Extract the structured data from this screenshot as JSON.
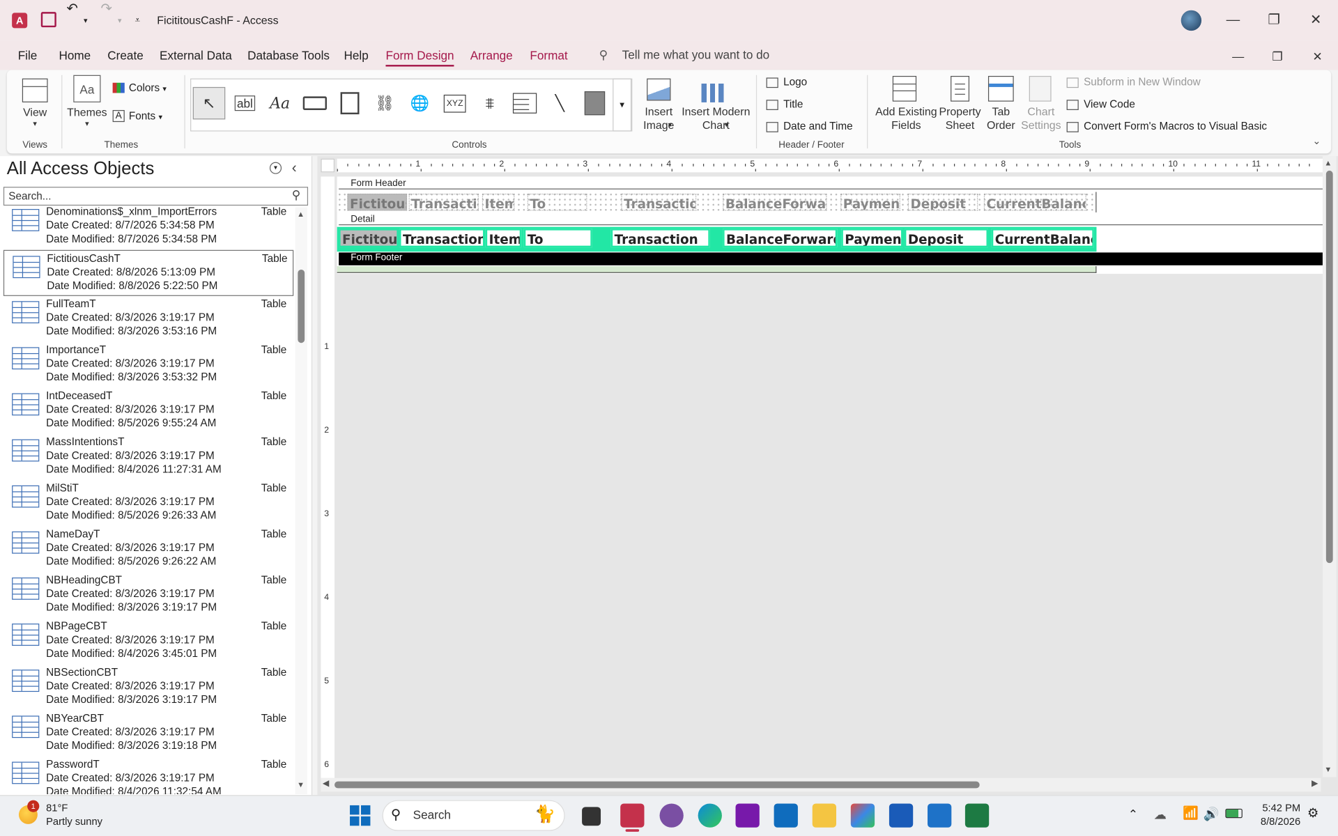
{
  "window": {
    "app_title": "FicititousCashF  -  Access"
  },
  "menu": {
    "file": "File",
    "home": "Home",
    "create": "Create",
    "external": "External Data",
    "dbtools": "Database Tools",
    "help": "Help",
    "form_design": "Form Design",
    "arrange": "Arrange",
    "format": "Format",
    "tellme": "Tell me what you want to do"
  },
  "ribbon": {
    "views": {
      "view": "View",
      "group": "Views"
    },
    "themes": {
      "themes": "Themes",
      "colors": "Colors",
      "fonts": "Fonts",
      "group": "Themes"
    },
    "controls": {
      "group": "Controls",
      "insert_image": "Insert Image",
      "insert_chart": "Insert Modern Chart"
    },
    "header_footer": {
      "logo": "Logo",
      "title": "Title",
      "date_time": "Date and Time",
      "group": "Header / Footer"
    },
    "tools": {
      "add_fields": "Add Existing Fields",
      "property_sheet": "Property Sheet",
      "tab_order": "Tab Order",
      "chart_settings": "Chart Settings",
      "subform": "Subform in New Window",
      "view_code": "View Code",
      "convert": "Convert Form's Macros to Visual Basic",
      "group": "Tools"
    }
  },
  "nav": {
    "title": "All Access Objects",
    "search_placeholder": "Search...",
    "items": [
      {
        "name": "Denominations$_xlnm_ImportErrors",
        "created": "Date Created: 8/7/2026 5:34:58 PM",
        "modified": "Date Modified: 8/7/2026 5:34:58 PM",
        "type": "Table"
      },
      {
        "name": "FictitiousCashT",
        "created": "Date Created: 8/8/2026 5:13:09 PM",
        "modified": "Date Modified: 8/8/2026 5:22:50 PM",
        "type": "Table"
      },
      {
        "name": "FullTeamT",
        "created": "Date Created: 8/3/2026 3:19:17 PM",
        "modified": "Date Modified: 8/3/2026 3:53:16 PM",
        "type": "Table"
      },
      {
        "name": "ImportanceT",
        "created": "Date Created: 8/3/2026 3:19:17 PM",
        "modified": "Date Modified: 8/3/2026 3:53:32 PM",
        "type": "Table"
      },
      {
        "name": "IntDeceasedT",
        "created": "Date Created: 8/3/2026 3:19:17 PM",
        "modified": "Date Modified: 8/5/2026 9:55:24 AM",
        "type": "Table"
      },
      {
        "name": "MassIntentionsT",
        "created": "Date Created: 8/3/2026 3:19:17 PM",
        "modified": "Date Modified: 8/4/2026 11:27:31 AM",
        "type": "Table"
      },
      {
        "name": "MilStiT",
        "created": "Date Created: 8/3/2026 3:19:17 PM",
        "modified": "Date Modified: 8/5/2026 9:26:33 AM",
        "type": "Table"
      },
      {
        "name": "NameDayT",
        "created": "Date Created: 8/3/2026 3:19:17 PM",
        "modified": "Date Modified: 8/5/2026 9:26:22 AM",
        "type": "Table"
      },
      {
        "name": "NBHeadingCBT",
        "created": "Date Created: 8/3/2026 3:19:17 PM",
        "modified": "Date Modified: 8/3/2026 3:19:17 PM",
        "type": "Table"
      },
      {
        "name": "NBPageCBT",
        "created": "Date Created: 8/3/2026 3:19:17 PM",
        "modified": "Date Modified: 8/4/2026 3:45:01 PM",
        "type": "Table"
      },
      {
        "name": "NBSectionCBT",
        "created": "Date Created: 8/3/2026 3:19:17 PM",
        "modified": "Date Modified: 8/3/2026 3:19:17 PM",
        "type": "Table"
      },
      {
        "name": "NBYearCBT",
        "created": "Date Created: 8/3/2026 3:19:17 PM",
        "modified": "Date Modified: 8/3/2026 3:19:18 PM",
        "type": "Table"
      },
      {
        "name": "PasswordT",
        "created": "Date Created: 8/3/2026 3:19:17 PM",
        "modified": "Date Modified: 8/4/2026 11:32:54 AM",
        "type": "Table"
      }
    ]
  },
  "design": {
    "sections": {
      "header": "Form Header",
      "detail": "Detail",
      "footer": "Form Footer"
    },
    "ruler_h": [
      "1",
      "2",
      "3",
      "4",
      "5",
      "6",
      "7",
      "8",
      "9",
      "10",
      "11"
    ],
    "ruler_v": [
      "1",
      "2",
      "3",
      "4",
      "5",
      "6"
    ],
    "header_labels": [
      "FictitousC",
      "Transactior",
      "Item",
      "To",
      "Transaction",
      "BalanceForward",
      "Payment",
      "Deposit",
      "CurrentBalance"
    ],
    "detail_fields": [
      "FictitousC",
      "TransactionDe",
      "Item",
      "To",
      "Transaction",
      "BalanceForward",
      "Payment",
      "Deposit",
      "CurrentBalance"
    ]
  },
  "taskbar": {
    "weather_temp": "81°F",
    "weather_desc": "Partly sunny",
    "weather_badge": "1",
    "search": "Search",
    "time": "5:42 PM",
    "date": "8/8/2026"
  }
}
